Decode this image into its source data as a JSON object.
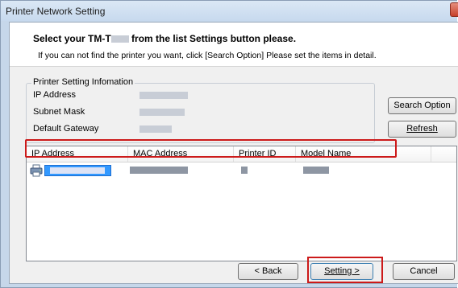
{
  "window": {
    "title": "Printer Network Setting"
  },
  "header": {
    "title_prefix": "Select your TM-T",
    "title_suffix": " from the list Settings button please.",
    "subtitle": "If you can not find the printer you want, click [Search Option] Please set the items in detail."
  },
  "printer_info": {
    "legend": "Printer Setting Infomation",
    "rows": [
      {
        "label": "IP Address"
      },
      {
        "label": "Subnet Mask"
      },
      {
        "label": "Default Gateway"
      }
    ]
  },
  "side_buttons": {
    "search_label": "Search Option",
    "refresh_label": "Refresh"
  },
  "list": {
    "columns": [
      "IP Address",
      "MAC Address",
      "Printer ID",
      "Model Name"
    ],
    "row_count": 1
  },
  "footer": {
    "back_label": "< Back",
    "setting_label": "Setting >",
    "cancel_label": "Cancel"
  },
  "colors": {
    "selection": "#3399ff",
    "highlight": "#cc1a1a",
    "titlebar": "#c7d9ee"
  },
  "icons": [
    "printer-icon",
    "close-icon"
  ]
}
